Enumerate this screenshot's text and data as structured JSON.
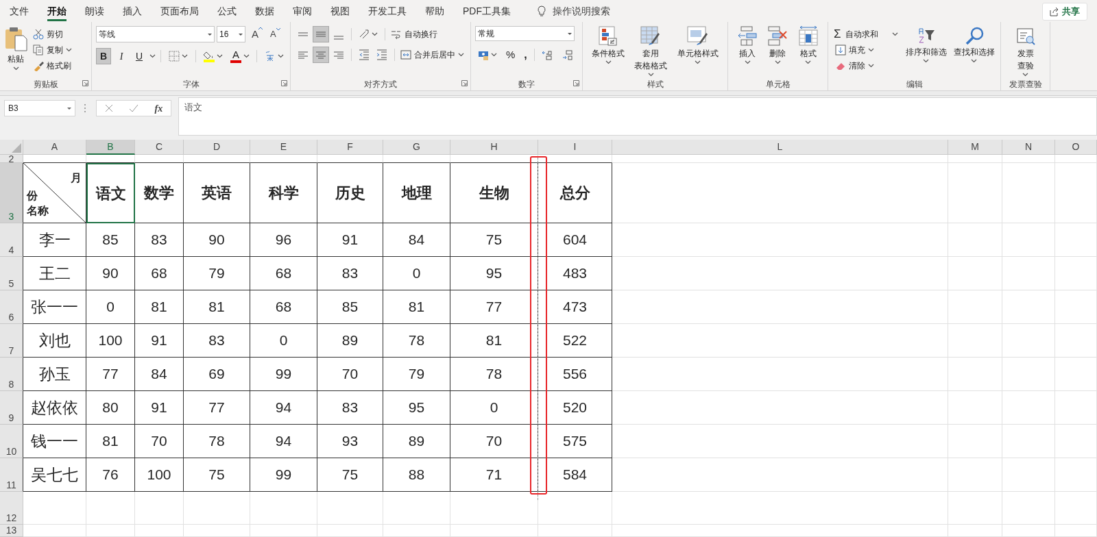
{
  "menu_tabs": [
    {
      "label": "文件",
      "selected": false
    },
    {
      "label": "开始",
      "selected": true
    },
    {
      "label": "朗读",
      "selected": false
    },
    {
      "label": "插入",
      "selected": false
    },
    {
      "label": "页面布局",
      "selected": false
    },
    {
      "label": "公式",
      "selected": false
    },
    {
      "label": "数据",
      "selected": false
    },
    {
      "label": "审阅",
      "selected": false
    },
    {
      "label": "视图",
      "selected": false
    },
    {
      "label": "开发工具",
      "selected": false
    },
    {
      "label": "帮助",
      "selected": false
    },
    {
      "label": "PDF工具集",
      "selected": false
    }
  ],
  "tell_me": "操作说明搜索",
  "share_button": "共享",
  "ribbon": {
    "clipboard": {
      "paste": "粘贴",
      "cut": "剪切",
      "copy": "复制",
      "format_painter": "格式刷",
      "label": "剪贴板"
    },
    "font": {
      "font_name": "等线",
      "font_size": "16",
      "grow": "A",
      "shrink": "A",
      "styles": [
        {
          "text": "B",
          "pressed": true
        },
        {
          "text": "I",
          "pressed": false
        },
        {
          "text": "U",
          "pressed": false
        }
      ],
      "font_color": "A",
      "label": "字体"
    },
    "alignment": {
      "align_middle": true,
      "align_center": true,
      "wrap_text": "自动换行",
      "merge_center": "合并后居中",
      "label": "对齐方式"
    },
    "number": {
      "format": "常规",
      "percent": "%",
      "comma": ",",
      "label": "数字"
    },
    "styles": {
      "conditional_formatting": "条件格式",
      "format_as_table": [
        "套用",
        "表格格式"
      ],
      "cell_styles": "单元格样式",
      "label": "样式"
    },
    "cells": {
      "insert": "插入",
      "delete": "删除",
      "format": "格式",
      "label": "单元格"
    },
    "editing": {
      "autosum_symbol": "Σ",
      "autosum": "自动求和",
      "fill": "填充",
      "clear": "清除",
      "sort_filter": "排序和筛选",
      "find_select": "查找和选择",
      "label": "编辑"
    },
    "invoice": {
      "verify": [
        "发票",
        "查验"
      ],
      "label": "发票查验"
    }
  },
  "formula_bar": {
    "name_box": "B3",
    "fx": "fx",
    "formula": "语文"
  },
  "sheet": {
    "columns": [
      {
        "label": "A",
        "selected": false
      },
      {
        "label": "B",
        "selected": true
      },
      {
        "label": "C",
        "selected": false
      },
      {
        "label": "D",
        "selected": false
      },
      {
        "label": "E",
        "selected": false
      },
      {
        "label": "F",
        "selected": false
      },
      {
        "label": "G",
        "selected": false
      },
      {
        "label": "H",
        "selected": false
      },
      {
        "label": "I",
        "selected": false
      },
      {
        "label": "L",
        "selected": false
      },
      {
        "label": "M",
        "selected": false
      },
      {
        "label": "N",
        "selected": false
      },
      {
        "label": "O",
        "selected": false
      }
    ],
    "row_numbers": [
      {
        "label": "2",
        "selected": false
      },
      {
        "label": "3",
        "selected": true
      },
      {
        "label": "4",
        "selected": false
      },
      {
        "label": "5",
        "selected": false
      },
      {
        "label": "6",
        "selected": false
      },
      {
        "label": "7",
        "selected": false
      },
      {
        "label": "8",
        "selected": false
      },
      {
        "label": "9",
        "selected": false
      },
      {
        "label": "10",
        "selected": false
      },
      {
        "label": "11",
        "selected": false
      },
      {
        "label": "12",
        "selected": false
      },
      {
        "label": "13",
        "selected": false
      }
    ],
    "corner": {
      "top_right": "月",
      "bottom_left": [
        "份",
        "名称"
      ]
    },
    "headers": [
      {
        "text": "语文",
        "selected": true
      },
      {
        "text": "数学",
        "selected": false
      },
      {
        "text": "英语",
        "selected": false
      },
      {
        "text": "科学",
        "selected": false
      },
      {
        "text": "历史",
        "selected": false
      },
      {
        "text": "地理",
        "selected": false
      },
      {
        "text": "生物",
        "selected": false
      },
      {
        "text": "总分",
        "selected": false
      }
    ],
    "records": [
      {
        "name": "李一",
        "scores": [
          "85",
          "83",
          "90",
          "96",
          "91",
          "84",
          "75"
        ],
        "total": "604"
      },
      {
        "name": "王二",
        "scores": [
          "90",
          "68",
          "79",
          "68",
          "83",
          "0",
          "95"
        ],
        "total": "483"
      },
      {
        "name": "张一一",
        "scores": [
          "0",
          "81",
          "81",
          "68",
          "85",
          "81",
          "77"
        ],
        "total": "473"
      },
      {
        "name": "刘也",
        "scores": [
          "100",
          "91",
          "83",
          "0",
          "89",
          "78",
          "81"
        ],
        "total": "522"
      },
      {
        "name": "孙玉",
        "scores": [
          "77",
          "84",
          "69",
          "99",
          "70",
          "79",
          "78"
        ],
        "total": "556"
      },
      {
        "name": "赵依依",
        "scores": [
          "80",
          "91",
          "77",
          "94",
          "83",
          "95",
          "0"
        ],
        "total": "520"
      },
      {
        "name": "钱一一",
        "scores": [
          "81",
          "70",
          "78",
          "94",
          "93",
          "89",
          "70"
        ],
        "total": "575"
      },
      {
        "name": "吴七七",
        "scores": [
          "76",
          "100",
          "75",
          "99",
          "75",
          "88",
          "71"
        ],
        "total": "584"
      }
    ]
  }
}
